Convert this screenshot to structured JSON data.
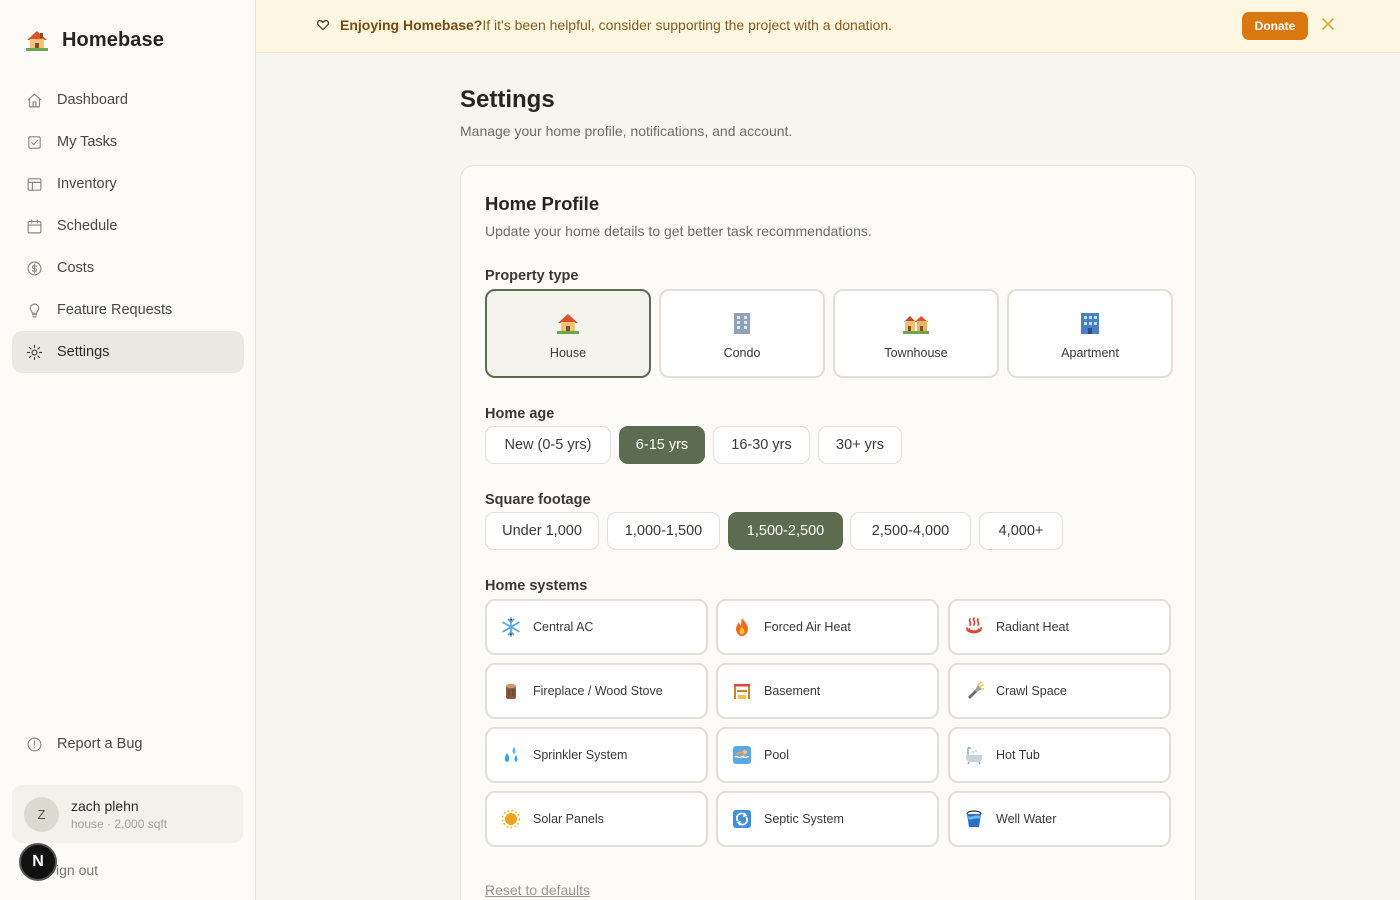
{
  "app": {
    "name": "Homebase",
    "logo_icon": "house-emoji-icon"
  },
  "sidebar": {
    "items": [
      {
        "label": "Dashboard",
        "icon": "home-icon",
        "active": false
      },
      {
        "label": "My Tasks",
        "icon": "checkbox-icon",
        "active": false
      },
      {
        "label": "Inventory",
        "icon": "layout-icon",
        "active": false
      },
      {
        "label": "Schedule",
        "icon": "calendar-icon",
        "active": false
      },
      {
        "label": "Costs",
        "icon": "dollar-circle-icon",
        "active": false
      },
      {
        "label": "Feature Requests",
        "icon": "lightbulb-icon",
        "active": false
      },
      {
        "label": "Settings",
        "icon": "sun-gear-icon",
        "active": true
      }
    ],
    "report_bug": "Report a Bug",
    "user": {
      "initial": "Z",
      "name": "zach plehn",
      "meta": "house · 2,000 sqft"
    },
    "sign_out": "ign out",
    "dev_badge": "N"
  },
  "banner": {
    "bold": "Enjoying Homebase?",
    "text": "If it's been helpful, consider supporting the project with a donation.",
    "donate": "Donate",
    "accent": "#d9780f"
  },
  "page": {
    "title": "Settings",
    "subtitle": "Manage your home profile, notifications, and account."
  },
  "home_profile": {
    "title": "Home Profile",
    "subtitle": "Update your home details to get better task recommendations.",
    "property_type_label": "Property type",
    "property_types": [
      {
        "label": "House",
        "icon": "house-icon",
        "selected": true
      },
      {
        "label": "Condo",
        "icon": "office-building-icon",
        "selected": false
      },
      {
        "label": "Townhouse",
        "icon": "houses-icon",
        "selected": false
      },
      {
        "label": "Apartment",
        "icon": "apartment-building-icon",
        "selected": false
      }
    ],
    "home_age_label": "Home age",
    "home_ages": [
      {
        "label": "New (0-5 yrs)",
        "selected": false
      },
      {
        "label": "6-15 yrs",
        "selected": true
      },
      {
        "label": "16-30 yrs",
        "selected": false
      },
      {
        "label": "30+ yrs",
        "selected": false
      }
    ],
    "sqft_label": "Square footage",
    "sqft_options": [
      {
        "label": "Under 1,000",
        "selected": false
      },
      {
        "label": "1,000-1,500",
        "selected": false
      },
      {
        "label": "1,500-2,500",
        "selected": true
      },
      {
        "label": "2,500-4,000",
        "selected": false
      },
      {
        "label": "4,000+",
        "selected": false
      }
    ],
    "systems_label": "Home systems",
    "systems": [
      {
        "label": "Central AC",
        "icon": "snowflake-icon"
      },
      {
        "label": "Forced Air Heat",
        "icon": "fire-icon"
      },
      {
        "label": "Radiant Heat",
        "icon": "hot-springs-icon"
      },
      {
        "label": "Fireplace / Wood Stove",
        "icon": "wood-log-icon"
      },
      {
        "label": "Basement",
        "icon": "construction-icon"
      },
      {
        "label": "Crawl Space",
        "icon": "flashlight-icon"
      },
      {
        "label": "Sprinkler System",
        "icon": "water-drops-icon"
      },
      {
        "label": "Pool",
        "icon": "swimmer-icon"
      },
      {
        "label": "Hot Tub",
        "icon": "bathtub-icon"
      },
      {
        "label": "Solar Panels",
        "icon": "sun-icon"
      },
      {
        "label": "Septic System",
        "icon": "recycle-arrows-icon"
      },
      {
        "label": "Well Water",
        "icon": "bucket-icon"
      }
    ],
    "reset": "Reset to defaults",
    "selected_color": "#5d6b50"
  }
}
